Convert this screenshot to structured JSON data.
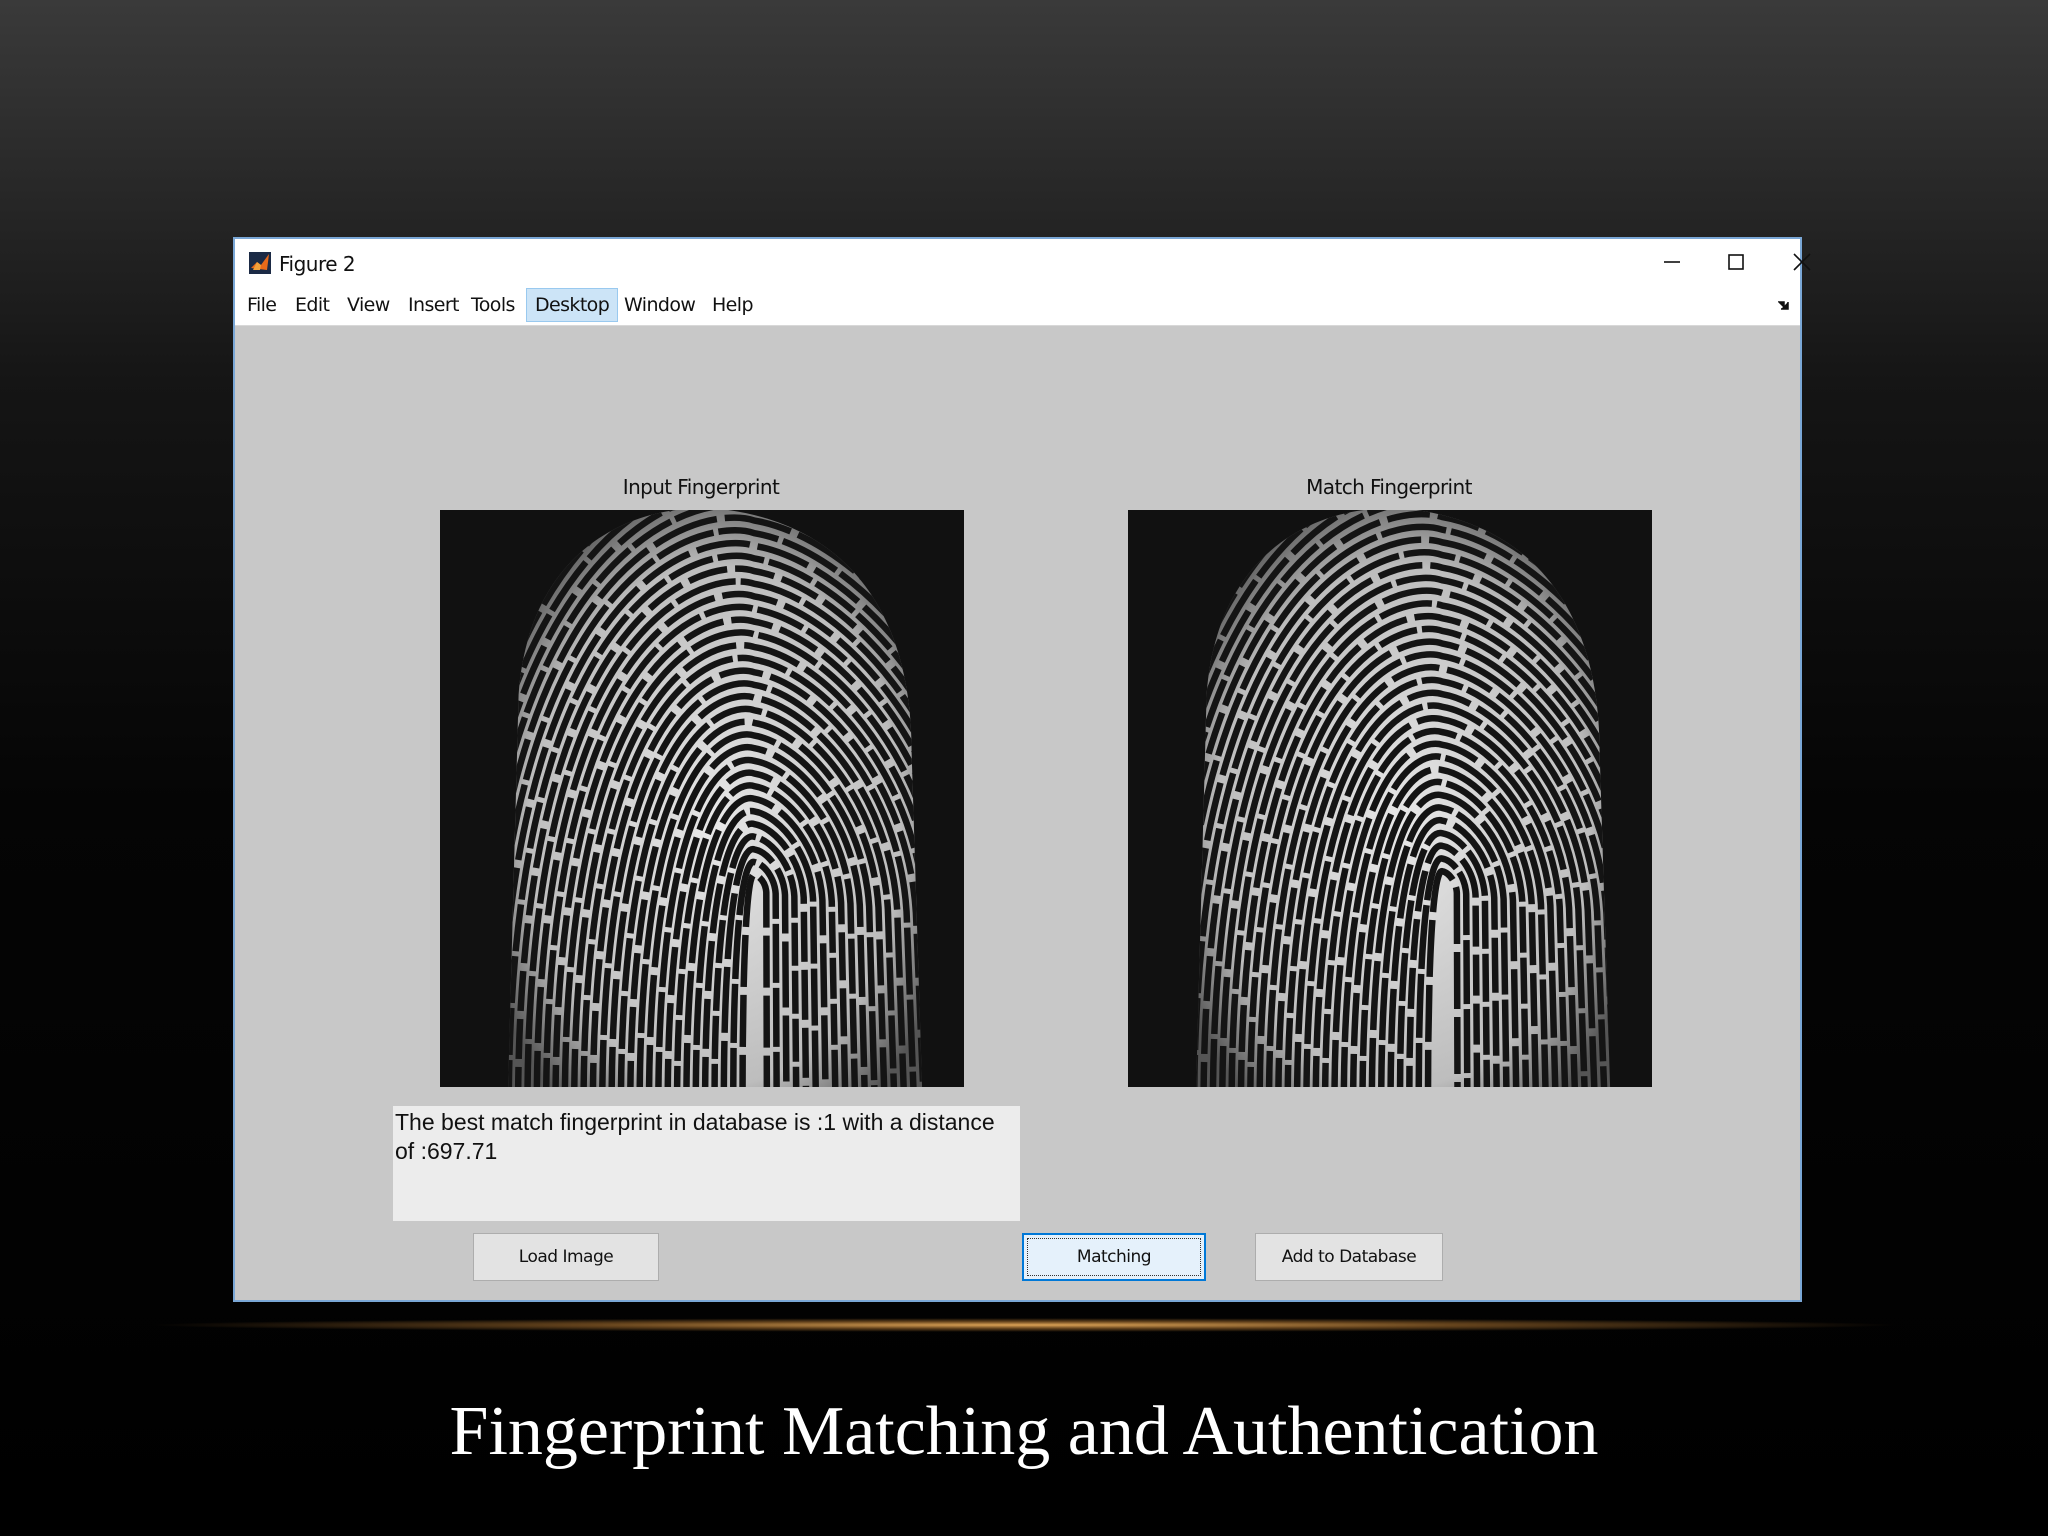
{
  "window": {
    "title": "Figure 2",
    "menu": [
      "File",
      "Edit",
      "View",
      "Insert",
      "Tools",
      "Desktop",
      "Window",
      "Help"
    ],
    "active_menu": "Desktop"
  },
  "panels": {
    "input_title": "Input Fingerprint",
    "match_title": "Match Fingerprint"
  },
  "result": {
    "line1": "The best match fingerprint in database is  :1 with a distance",
    "line2": "of :697.71"
  },
  "buttons": {
    "load": "Load Image",
    "matching": "Matching",
    "add": "Add to Database"
  },
  "slide": {
    "caption": "Fingerprint Matching and Authentication"
  },
  "icons": {
    "app": "matlab-logo-icon",
    "minimize": "minimize-icon",
    "maximize": "maximize-icon",
    "close": "close-icon",
    "dock": "dock-arrow-icon"
  }
}
